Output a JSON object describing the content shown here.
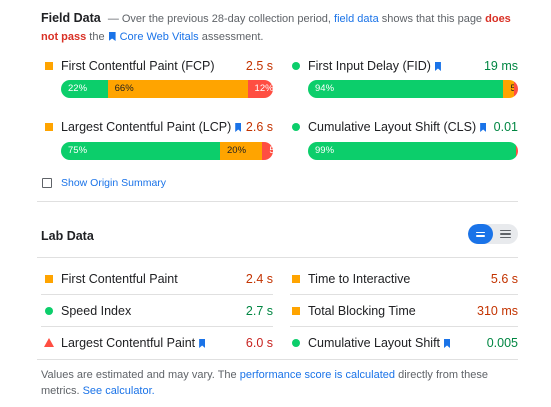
{
  "field": {
    "title": "Field Data",
    "desc_1": "— Over the previous 28-day collection period,",
    "desc_link": "field data",
    "desc_2": "shows that this page",
    "desc_warn": "does not pass",
    "desc_3": "the",
    "cwv_link": "Core Web Vitals",
    "desc_4": "assessment.",
    "metrics": [
      {
        "label": "First Contentful Paint (FCP)",
        "value": "2.5 s",
        "marker": "average",
        "dist": {
          "good": "22%",
          "avg": "66%",
          "poor": "12%"
        },
        "dist_values": [
          22,
          66,
          12
        ]
      },
      {
        "label": "First Input Delay (FID)",
        "value": "19 ms",
        "marker": "good",
        "dist": {
          "good": "94%",
          "avg": "5%",
          "poor": "2%"
        },
        "dist_values": [
          94,
          5,
          2
        ]
      },
      {
        "label": "Largest Contentful Paint (LCP)",
        "value": "2.6 s",
        "marker": "average",
        "dist": {
          "good": "75%",
          "avg": "20%",
          "poor": "5%"
        },
        "dist_values": [
          75,
          20,
          5
        ]
      },
      {
        "label": "Cumulative Layout Shift (CLS)",
        "value": "0.01",
        "marker": "good",
        "dist": {
          "good": "99%",
          "avg": "",
          "poor": ""
        },
        "dist_values": [
          99,
          0,
          1
        ]
      }
    ],
    "origin_summary": "Show Origin Summary"
  },
  "lab": {
    "title": "Lab Data",
    "metrics": [
      {
        "label": "First Contentful Paint",
        "value": "2.4 s",
        "marker": "average"
      },
      {
        "label": "Time to Interactive",
        "value": "5.6 s",
        "marker": "average"
      },
      {
        "label": "Speed Index",
        "value": "2.7 s",
        "marker": "good"
      },
      {
        "label": "Total Blocking Time",
        "value": "310 ms",
        "marker": "average"
      },
      {
        "label": "Largest Contentful Paint",
        "value": "6.0 s",
        "marker": "poor"
      },
      {
        "label": "Cumulative Layout Shift",
        "value": "0.005",
        "marker": "good"
      }
    ]
  },
  "footer": {
    "text_1": "Values are estimated and may vary. The",
    "link_1": "performance score is calculated",
    "text_2": "directly from these metrics.",
    "link_2": "See calculator."
  },
  "colors": {
    "good": "#0cce6b",
    "average": "#ffa400",
    "poor": "#ff4e42",
    "link": "#1a73e8"
  },
  "icons": [
    "bookmark-icon",
    "checkbox-icon",
    "view-toggle-icon"
  ]
}
